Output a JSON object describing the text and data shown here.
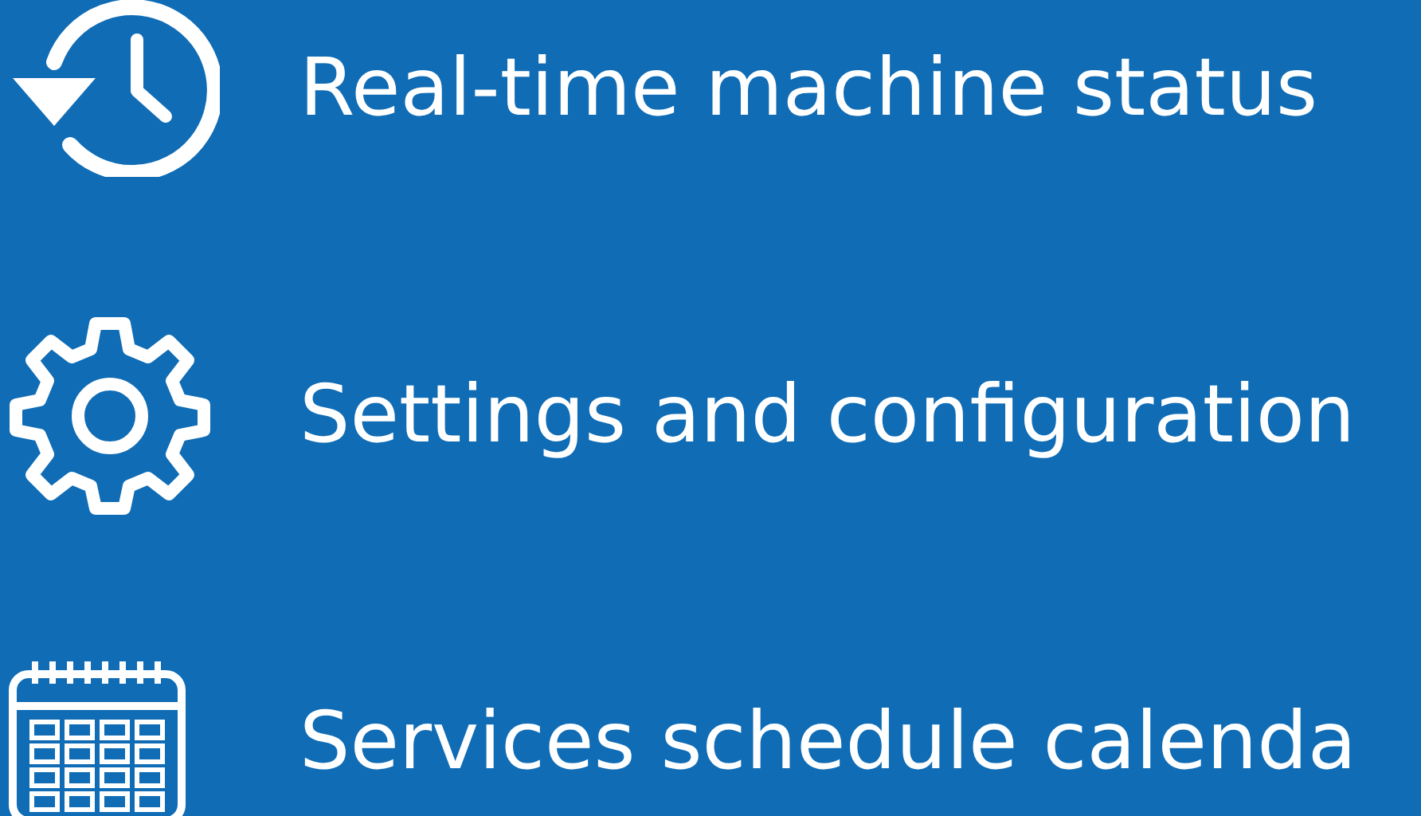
{
  "features": [
    {
      "kind": "history",
      "label": "Real-time machine status"
    },
    {
      "kind": "gear",
      "label": "Settings and configuration"
    },
    {
      "kind": "calendar",
      "label": "Services schedule calenda"
    }
  ]
}
